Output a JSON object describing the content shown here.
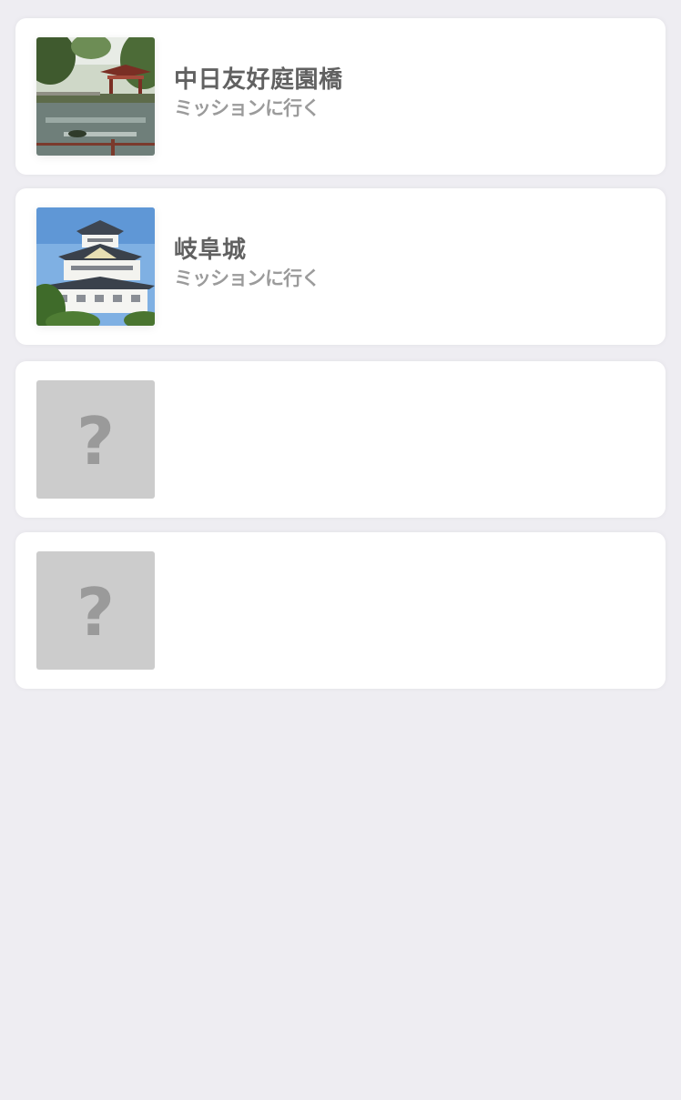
{
  "missions": [
    {
      "title": "中日友好庭園橋",
      "cta": "ミッションに行く",
      "thumbnail": "garden-pavilion-photo",
      "locked": false
    },
    {
      "title": "岐阜城",
      "cta": "ミッションに行く",
      "thumbnail": "gifu-castle-photo",
      "locked": false
    },
    {
      "placeholder": "?",
      "locked": true
    },
    {
      "placeholder": "?",
      "locked": true
    }
  ],
  "colors": {
    "background": "#eeedf2",
    "card": "#ffffff",
    "title": "#616161",
    "cta": "#9b9b9b",
    "locked_thumb": "#cccccc",
    "locked_mark": "#9a9a9a"
  }
}
